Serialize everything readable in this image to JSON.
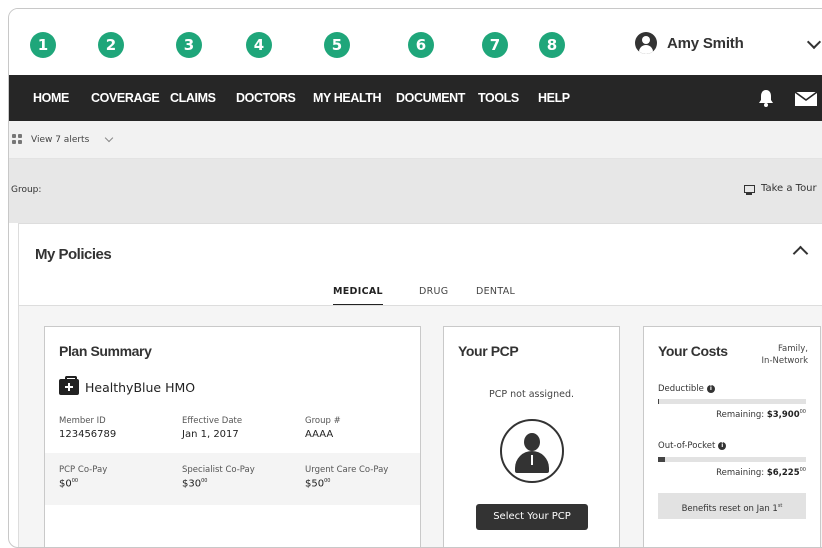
{
  "badges": [
    "1",
    "2",
    "3",
    "4",
    "5",
    "6",
    "7",
    "8"
  ],
  "user": {
    "name": "Amy Smith",
    "icon": "user-circle-icon",
    "menu_icon": "chevron-down-icon"
  },
  "nav": {
    "items": [
      "HOME",
      "COVERAGE",
      "CLAIMS",
      "DOCTORS",
      "MY HEALTH",
      "DOCUMENT",
      "TOOLS",
      "HELP"
    ],
    "icons": [
      "bell-icon",
      "mail-icon"
    ],
    "background": "#262626"
  },
  "alerts": {
    "label": "View 7 alerts"
  },
  "group": {
    "label": "Group:",
    "tour_label": "Take a Tour"
  },
  "policies": {
    "title": "My Policies",
    "tabs": [
      "MEDICAL",
      "DRUG",
      "DENTAL"
    ],
    "active_tab": "MEDICAL",
    "plan_summary": {
      "title": "Plan Summary",
      "plan_name": "HealthyBlue HMO",
      "fields": [
        {
          "label": "Member ID",
          "value": "123456789"
        },
        {
          "label": "Effective Date",
          "value": "Jan 1, 2017"
        },
        {
          "label": "Group #",
          "value": "AAAA"
        }
      ],
      "copays": [
        {
          "label": "PCP Co-Pay",
          "value": "$0",
          "cents": "00"
        },
        {
          "label": "Specialist Co-Pay",
          "value": "$30",
          "cents": "00"
        },
        {
          "label": "Urgent Care Co-Pay",
          "value": "$50",
          "cents": "00"
        }
      ]
    },
    "pcp": {
      "title": "Your PCP",
      "status": "PCP not assigned.",
      "button": "Select Your PCP"
    },
    "costs": {
      "title": "Your Costs",
      "note_line1": "Family,",
      "note_line2": "In-Network",
      "deductible": {
        "label": "Deductible",
        "remaining_label": "Remaining:",
        "remaining": "$3,900",
        "cents": "00",
        "progress": 0.01
      },
      "oop": {
        "label": "Out-of-Pocket",
        "remaining_label": "Remaining:",
        "remaining": "$6,225",
        "cents": "00",
        "progress": 0.05
      },
      "reset_text": "Benefits reset on Jan 1",
      "reset_sup": "st"
    }
  },
  "colors": {
    "badge_green": "#1fa67a",
    "accent_dark": "#333333"
  }
}
